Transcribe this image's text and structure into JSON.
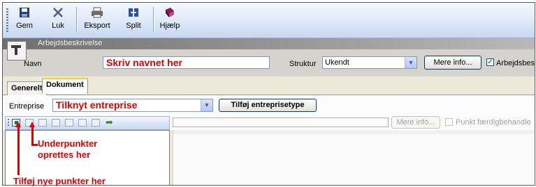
{
  "toolbar": {
    "buttons": [
      {
        "label": "Gem",
        "icon": "floppy-disk-icon"
      },
      {
        "label": "Luk",
        "icon": "close-x-icon"
      },
      {
        "label": "Eksport",
        "icon": "printer-icon"
      },
      {
        "label": "Split",
        "icon": "split-icon"
      },
      {
        "label": "Hjælp",
        "icon": "help-book-icon"
      }
    ]
  },
  "header": {
    "title": "Arbejdsbeskrivelse",
    "navn_label": "Navn",
    "navn_value": "Skriv navnet her",
    "struktur_label": "Struktur",
    "struktur_value": "Ukendt",
    "mere_info_label": "Mere info...",
    "arbejdsbeskrivelse_checkbox_label": "Arbejdsbeskrivels",
    "arbejdsbeskrivelse_checked": true
  },
  "tabs": [
    {
      "label": "Generelt",
      "active": false
    },
    {
      "label": "Dokument",
      "active": true
    }
  ],
  "entreprise": {
    "label": "Entreprise",
    "value": "Tilknyt entreprise",
    "add_button_label": "Tilføj entreprisetype"
  },
  "lower_bar": {
    "mere_info_label": "Mere info...",
    "punkt_label": "Punkt færdigbehandle"
  },
  "annotations": {
    "underpunkter": "Underpunkter\noprettes her",
    "underpunkter_line1": "Underpunkter",
    "underpunkter_line2": "oprettes her",
    "tilfoj": "Tilføj nye punkter her"
  },
  "colors": {
    "annotation": "#e00000",
    "toolbar_blue": "#c7d8f2",
    "tab_highlight": "#ffc83c"
  }
}
